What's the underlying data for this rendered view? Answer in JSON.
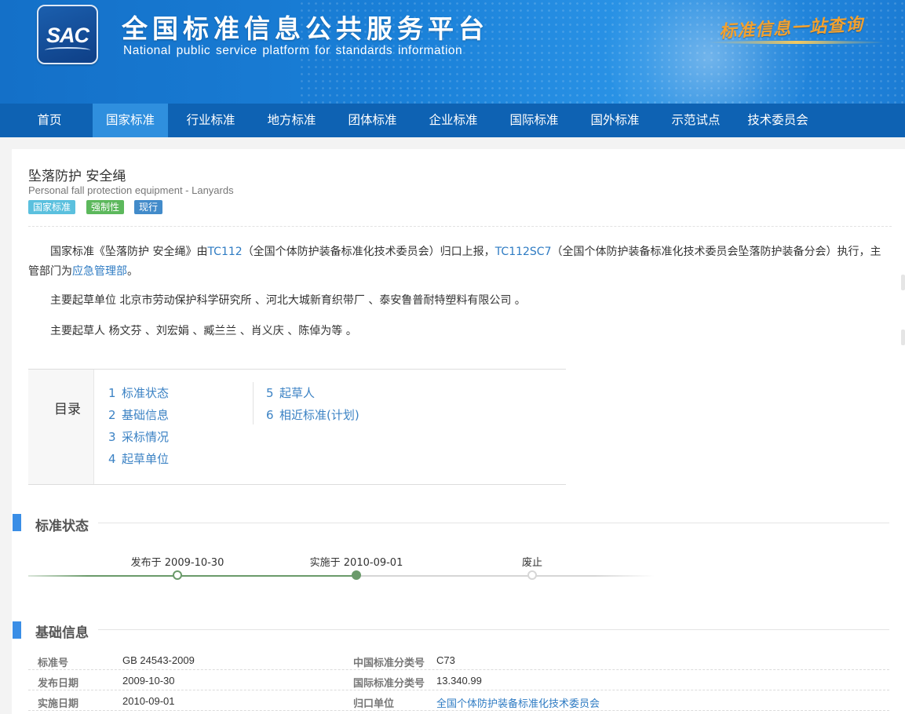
{
  "header": {
    "logo_text": "SAC",
    "title": "全国标准信息公共服务平台",
    "subtitle": "National public service platform  for standards information",
    "slogan": "标准信息一站查询"
  },
  "nav": {
    "items": [
      "首页",
      "国家标准",
      "行业标准",
      "地方标准",
      "团体标准",
      "企业标准",
      "国际标准",
      "国外标准",
      "示范试点",
      "技术委员会"
    ],
    "active": "国家标准"
  },
  "standard": {
    "title": "坠落防护 安全绳",
    "title_en": "Personal fall protection equipment - Lanyards",
    "badges": [
      {
        "text": "国家标准",
        "color": "#5bc0de"
      },
      {
        "text": "强制性",
        "color": "#5cb85c"
      },
      {
        "text": "现行",
        "color": "#428bca"
      }
    ]
  },
  "summary": {
    "p1_a": "国家标准《坠落防护 安全绳》由",
    "p1_tc": "TC112",
    "p1_b": "（全国个体防护装备标准化技术委员会）归口上报，",
    "p1_sc": "TC112SC7",
    "p1_c": "（全国个体防护装备标准化技术委员会坠落防护装备分会）执行，主管部门为",
    "p1_dept": "应急管理部",
    "p1_end": "。",
    "p2": "主要起草单位 北京市劳动保护科学研究所 、河北大城新育织带厂 、泰安鲁普耐特塑料有限公司 。",
    "p3": "主要起草人 杨文芬 、刘宏娟 、臧兰兰 、肖义庆 、陈倬为等 。"
  },
  "toc": {
    "label": "目录",
    "items": [
      {
        "num": "1",
        "text": "标准状态"
      },
      {
        "num": "2",
        "text": "基础信息"
      },
      {
        "num": "3",
        "text": "采标情况"
      },
      {
        "num": "4",
        "text": "起草单位"
      },
      {
        "num": "5",
        "text": "起草人"
      },
      {
        "num": "6",
        "text": "相近标准(计划)"
      }
    ]
  },
  "status_section": {
    "title": "标准状态",
    "published": "发布于 2009-10-30",
    "implemented": "实施于 2010-09-01",
    "abolished": "废止",
    "track_color": "#6a9a6a"
  },
  "basic_section": {
    "title": "基础信息",
    "rows": [
      {
        "k1": "标准号",
        "v1": "GB 24543-2009",
        "k2": "中国标准分类号",
        "v2": "C73",
        "v2_link": false
      },
      {
        "k1": "发布日期",
        "v1": "2009-10-30",
        "k2": "国际标准分类号",
        "v2": "13.340.99",
        "v2_link": false
      },
      {
        "k1": "实施日期",
        "v1": "2010-09-01",
        "k2": "归口单位",
        "v2": "全国个体防护装备标准化技术委员会",
        "v2_link": true
      }
    ]
  }
}
